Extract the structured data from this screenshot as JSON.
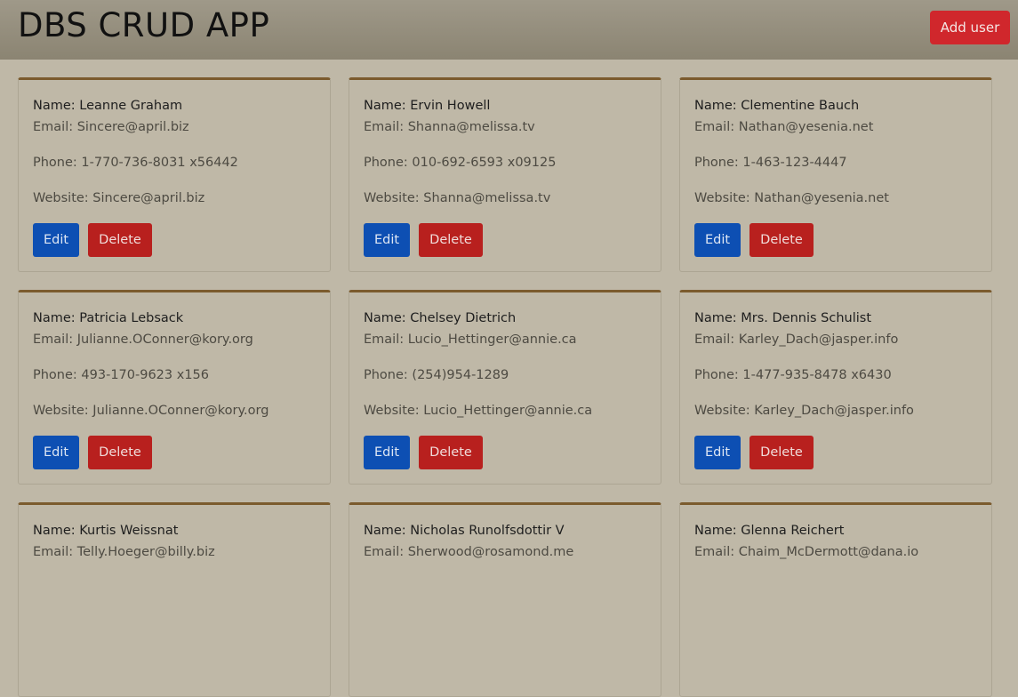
{
  "header": {
    "title": "DBS CRUD APP",
    "add_user_label": "Add user"
  },
  "colors": {
    "page_bg": "#bfb8a7",
    "header_bg": "#8b8472",
    "card_accent": "#7b5b2e",
    "edit_button": "#0d4fb3",
    "delete_button": "#b8201e",
    "add_button": "#d0272c"
  },
  "users": [
    {
      "name": "Name: Leanne Graham",
      "email": "Email: Sincere@april.biz",
      "phone": "Phone: 1-770-736-8031 x56442",
      "website": "Website: Sincere@april.biz",
      "edit_label": "Edit",
      "delete_label": "Delete"
    },
    {
      "name": "Name: Ervin Howell",
      "email": "Email: Shanna@melissa.tv",
      "phone": "Phone: 010-692-6593 x09125",
      "website": "Website: Shanna@melissa.tv",
      "edit_label": "Edit",
      "delete_label": "Delete"
    },
    {
      "name": "Name: Clementine Bauch",
      "email": "Email: Nathan@yesenia.net",
      "phone": "Phone: 1-463-123-4447",
      "website": "Website: Nathan@yesenia.net",
      "edit_label": "Edit",
      "delete_label": "Delete"
    },
    {
      "name": "Name: Patricia Lebsack",
      "email": "Email: Julianne.OConner@kory.org",
      "phone": "Phone: 493-170-9623 x156",
      "website": "Website: Julianne.OConner@kory.org",
      "edit_label": "Edit",
      "delete_label": "Delete"
    },
    {
      "name": "Name: Chelsey Dietrich",
      "email": "Email: Lucio_Hettinger@annie.ca",
      "phone": "Phone: (254)954-1289",
      "website": "Website: Lucio_Hettinger@annie.ca",
      "edit_label": "Edit",
      "delete_label": "Delete"
    },
    {
      "name": "Name: Mrs. Dennis Schulist",
      "email": "Email: Karley_Dach@jasper.info",
      "phone": "Phone: 1-477-935-8478 x6430",
      "website": "Website: Karley_Dach@jasper.info",
      "edit_label": "Edit",
      "delete_label": "Delete"
    },
    {
      "name": "Name: Kurtis Weissnat",
      "email": "Email: Telly.Hoeger@billy.biz",
      "phone": "",
      "website": "",
      "edit_label": "",
      "delete_label": ""
    },
    {
      "name": "Name: Nicholas Runolfsdottir V",
      "email": "Email: Sherwood@rosamond.me",
      "phone": "",
      "website": "",
      "edit_label": "",
      "delete_label": ""
    },
    {
      "name": "Name: Glenna Reichert",
      "email": "Email: Chaim_McDermott@dana.io",
      "phone": "",
      "website": "",
      "edit_label": "",
      "delete_label": ""
    }
  ]
}
